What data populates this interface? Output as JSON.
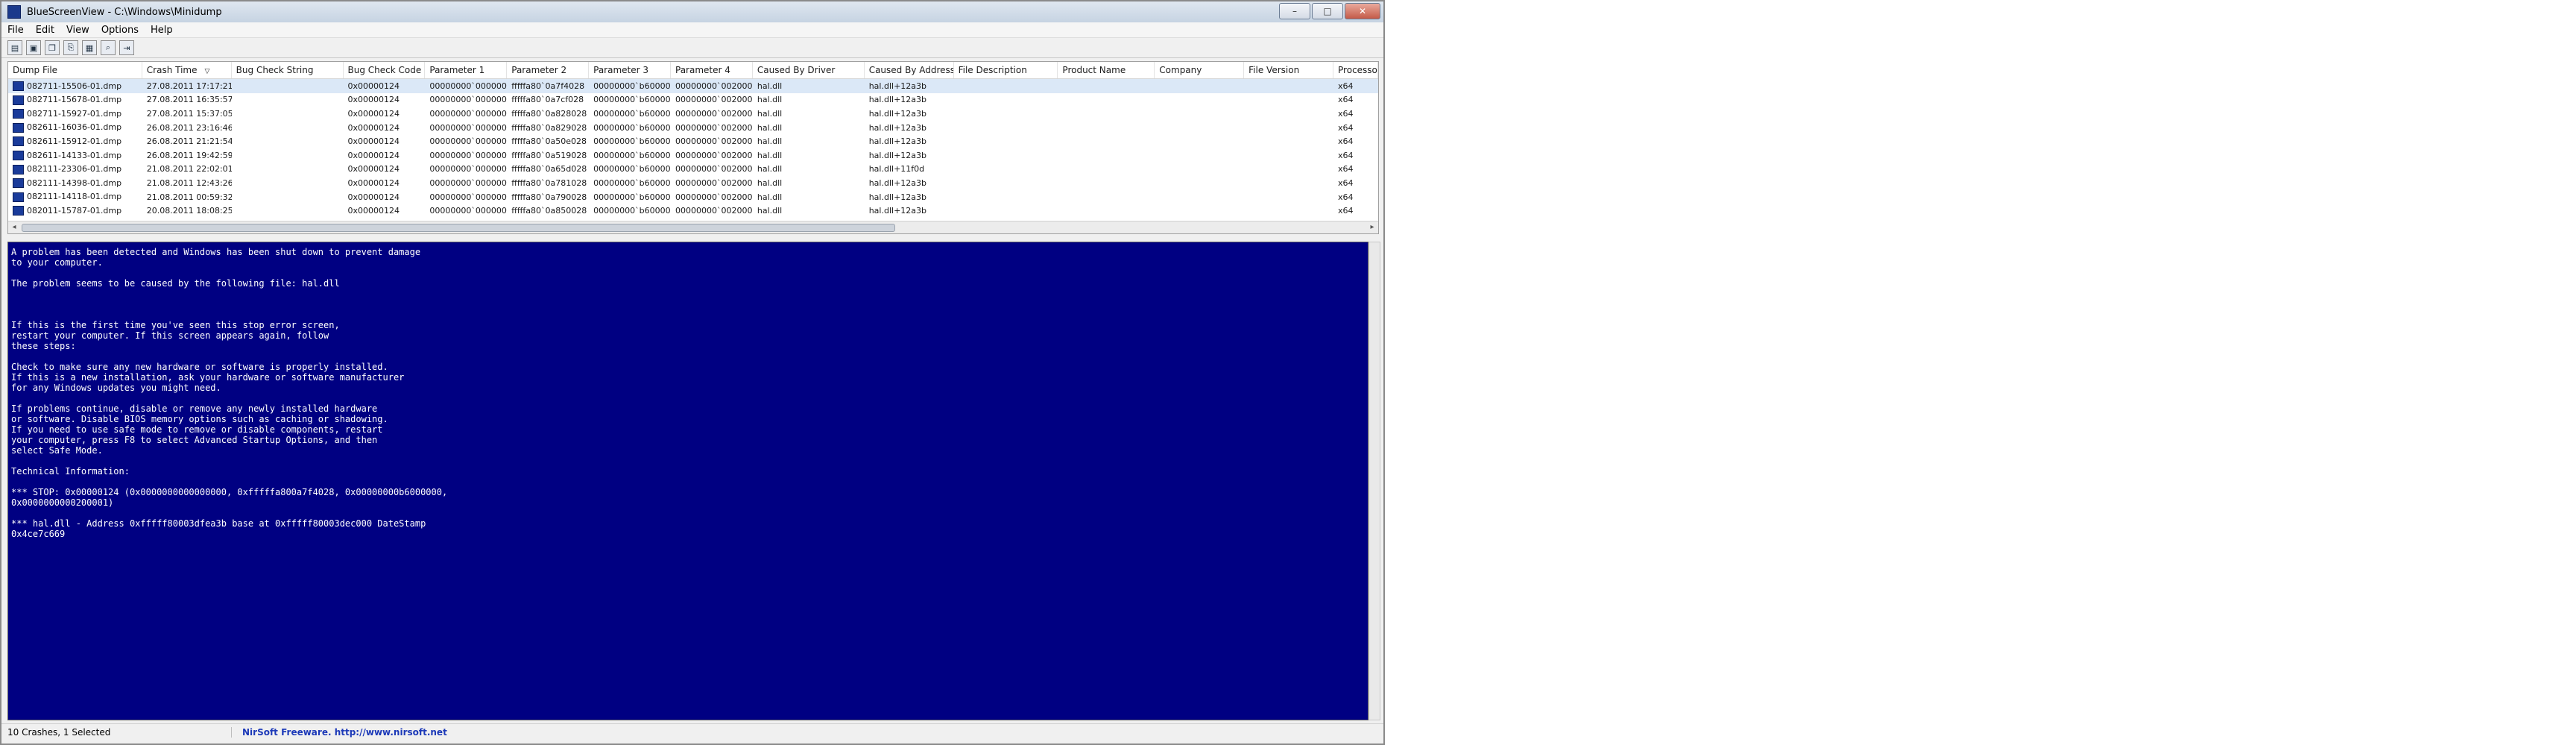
{
  "window": {
    "title": "BlueScreenView - C:\\Windows\\Minidump",
    "controls": [
      "–",
      "□",
      "✕"
    ]
  },
  "menu": [
    "File",
    "Edit",
    "View",
    "Options",
    "Help"
  ],
  "toolbar": [
    {
      "name": "open-icon",
      "glyph": "▤"
    },
    {
      "name": "save-icon",
      "glyph": "▣"
    },
    {
      "name": "copy-icon",
      "glyph": "❐"
    },
    {
      "name": "html-report-icon",
      "glyph": "⎘"
    },
    {
      "name": "properties-icon",
      "glyph": "▦"
    },
    {
      "name": "find-icon",
      "glyph": "⌕"
    },
    {
      "name": "exit-icon",
      "glyph": "⇥"
    }
  ],
  "columns": [
    "Dump File",
    "Crash Time",
    "Bug Check String",
    "Bug Check Code",
    "Parameter 1",
    "Parameter 2",
    "Parameter 3",
    "Parameter 4",
    "Caused By Driver",
    "Caused By Address",
    "File Description",
    "Product Name",
    "Company",
    "File Version",
    "Processor"
  ],
  "sort_indicator": "▽",
  "rows": [
    [
      "082711-15506-01.dmp",
      "27.08.2011 17:17:21",
      "",
      "0x00000124",
      "00000000`000000...",
      "fffffa80`0a7f4028",
      "00000000`b60000...",
      "00000000`002000...",
      "hal.dll",
      "hal.dll+12a3b",
      "",
      "",
      "",
      "",
      "x64"
    ],
    [
      "082711-15678-01.dmp",
      "27.08.2011 16:35:57",
      "",
      "0x00000124",
      "00000000`000000...",
      "fffffa80`0a7cf028",
      "00000000`b60000...",
      "00000000`002000...",
      "hal.dll",
      "hal.dll+12a3b",
      "",
      "",
      "",
      "",
      "x64"
    ],
    [
      "082711-15927-01.dmp",
      "27.08.2011 15:37:05",
      "",
      "0x00000124",
      "00000000`000000...",
      "fffffa80`0a828028",
      "00000000`b60000...",
      "00000000`002000...",
      "hal.dll",
      "hal.dll+12a3b",
      "",
      "",
      "",
      "",
      "x64"
    ],
    [
      "082611-16036-01.dmp",
      "26.08.2011 23:16:46",
      "",
      "0x00000124",
      "00000000`000000...",
      "fffffa80`0a829028",
      "00000000`b60000...",
      "00000000`002000...",
      "hal.dll",
      "hal.dll+12a3b",
      "",
      "",
      "",
      "",
      "x64"
    ],
    [
      "082611-15912-01.dmp",
      "26.08.2011 21:21:54",
      "",
      "0x00000124",
      "00000000`000000...",
      "fffffa80`0a50e028",
      "00000000`b60000...",
      "00000000`002000...",
      "hal.dll",
      "hal.dll+12a3b",
      "",
      "",
      "",
      "",
      "x64"
    ],
    [
      "082611-14133-01.dmp",
      "26.08.2011 19:42:59",
      "",
      "0x00000124",
      "00000000`000000...",
      "fffffa80`0a519028",
      "00000000`b60000...",
      "00000000`002000...",
      "hal.dll",
      "hal.dll+12a3b",
      "",
      "",
      "",
      "",
      "x64"
    ],
    [
      "082111-23306-01.dmp",
      "21.08.2011 22:02:01",
      "",
      "0x00000124",
      "00000000`000000...",
      "fffffa80`0a65d028",
      "00000000`b60000...",
      "00000000`002000...",
      "hal.dll",
      "hal.dll+11f0d",
      "",
      "",
      "",
      "",
      "x64"
    ],
    [
      "082111-14398-01.dmp",
      "21.08.2011 12:43:26",
      "",
      "0x00000124",
      "00000000`000000...",
      "fffffa80`0a781028",
      "00000000`b60000...",
      "00000000`002000...",
      "hal.dll",
      "hal.dll+12a3b",
      "",
      "",
      "",
      "",
      "x64"
    ],
    [
      "082111-14118-01.dmp",
      "21.08.2011 00:59:32",
      "",
      "0x00000124",
      "00000000`000000...",
      "fffffa80`0a790028",
      "00000000`b60000...",
      "00000000`002000...",
      "hal.dll",
      "hal.dll+12a3b",
      "",
      "",
      "",
      "",
      "x64"
    ],
    [
      "082011-15787-01.dmp",
      "20.08.2011 18:08:25",
      "",
      "0x00000124",
      "00000000`000000...",
      "fffffa80`0a850028",
      "00000000`b60000...",
      "00000000`002000...",
      "hal.dll",
      "hal.dll+12a3b",
      "",
      "",
      "",
      "",
      "x64"
    ]
  ],
  "selected_row": 0,
  "bsod_lines": [
    "A problem has been detected and Windows has been shut down to prevent damage",
    "to your computer.",
    "",
    "The problem seems to be caused by the following file: hal.dll",
    "",
    "",
    "",
    "If this is the first time you've seen this stop error screen,",
    "restart your computer. If this screen appears again, follow",
    "these steps:",
    "",
    "Check to make sure any new hardware or software is properly installed.",
    "If this is a new installation, ask your hardware or software manufacturer",
    "for any Windows updates you might need.",
    "",
    "If problems continue, disable or remove any newly installed hardware",
    "or software. Disable BIOS memory options such as caching or shadowing.",
    "If you need to use safe mode to remove or disable components, restart",
    "your computer, press F8 to select Advanced Startup Options, and then",
    "select Safe Mode.",
    "",
    "Technical Information:",
    "",
    "*** STOP: 0x00000124 (0x0000000000000000, 0xfffffa800a7f4028, 0x00000000b6000000,",
    "0x0000000000200001)",
    "",
    "*** hal.dll - Address 0xfffff80003dfea3b base at 0xfffff80003dec000 DateStamp",
    "0x4ce7c669"
  ],
  "status": {
    "count": "10 Crashes, 1 Selected",
    "link": "NirSoft Freeware.  http://www.nirsoft.net"
  }
}
